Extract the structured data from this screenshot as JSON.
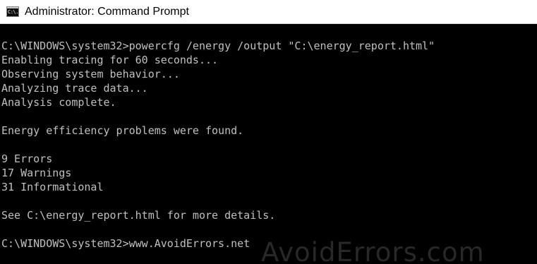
{
  "window": {
    "title": "Administrator: Command Prompt",
    "icon": "cmd-app-icon",
    "icon_label": "C:\\."
  },
  "console": {
    "lines": [
      "C:\\WINDOWS\\system32>powercfg /energy /output \"C:\\energy_report.html\"",
      "Enabling tracing for 60 seconds...",
      "Observing system behavior...",
      "Analyzing trace data...",
      "Analysis complete.",
      "",
      "Energy efficiency problems were found.",
      "",
      "9 Errors",
      "17 Warnings",
      "31 Informational",
      "",
      "See C:\\energy_report.html for more details.",
      "",
      "C:\\WINDOWS\\system32>www.AvoidErrors.net"
    ]
  },
  "watermark": "AvoidErrors.com",
  "colors": {
    "console_background": "#000000",
    "console_text": "#c0c0c0",
    "titlebar_background": "#ffffff"
  }
}
